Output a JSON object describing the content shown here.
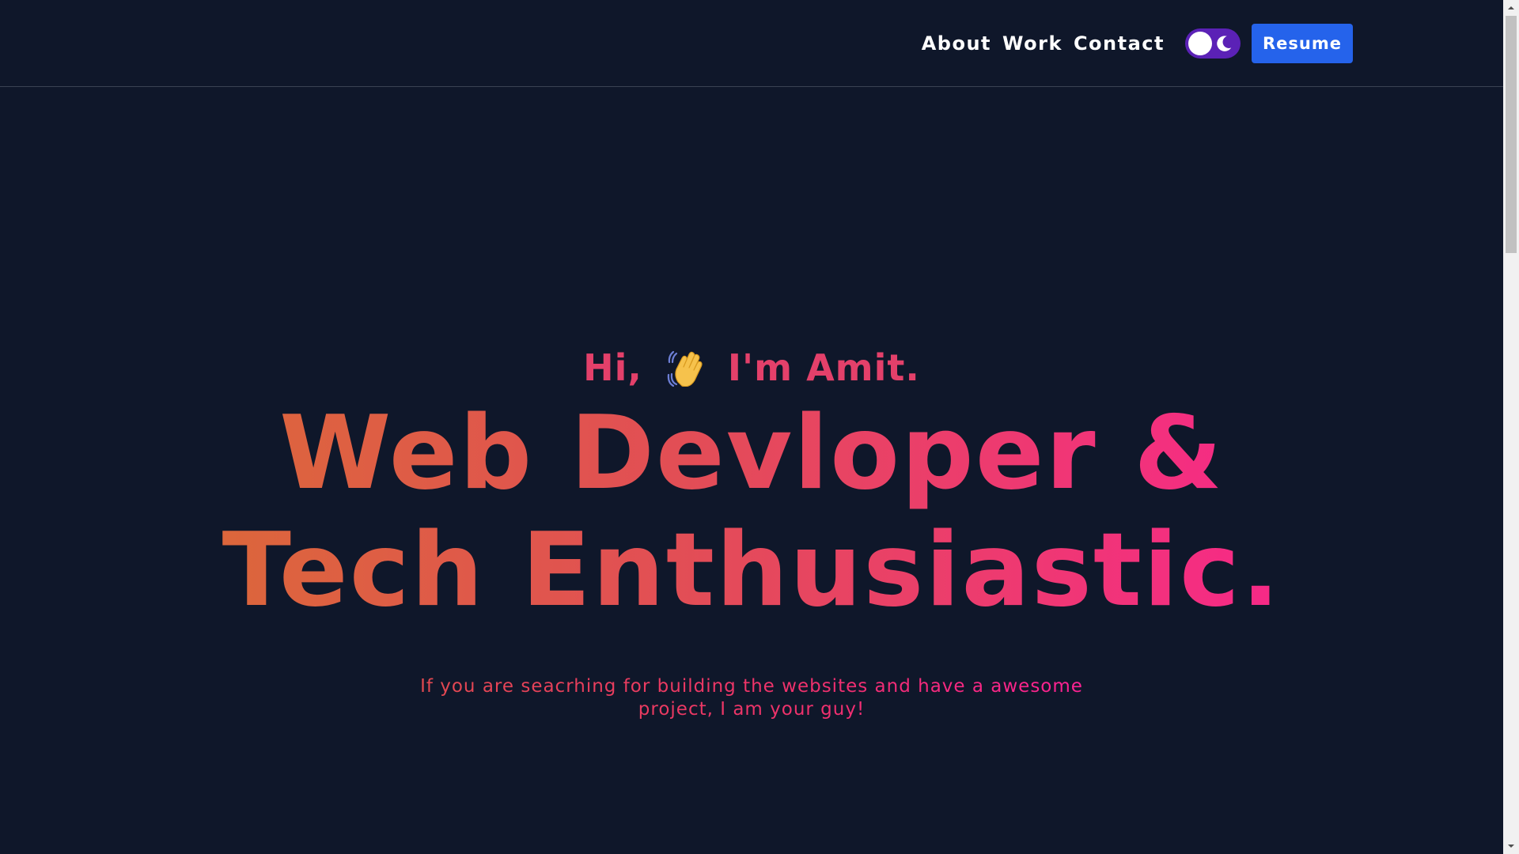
{
  "nav": {
    "links": [
      "About",
      "Work",
      "Contact"
    ],
    "theme_toggle": {
      "state": "dark",
      "icon": "moon-icon"
    },
    "resume_label": "Resume"
  },
  "hero": {
    "greeting_prefix": "Hi,",
    "greeting_icon": "waving-hand-icon",
    "greeting_suffix": "I'm Amit.",
    "headline_line1": "Web Devloper &",
    "headline_line2": "Tech Enthusiastic.",
    "tagline": "If you are seacrhing for building the websites and have a awesome project, I am your guy!"
  },
  "colors": {
    "background": "#0f172a",
    "accent_blue": "#2563eb",
    "toggle_purple": "#5b21b6",
    "gradient_start": "#d9722f",
    "gradient_mid": "#e24e55",
    "gradient_end": "#ff1b9a"
  }
}
